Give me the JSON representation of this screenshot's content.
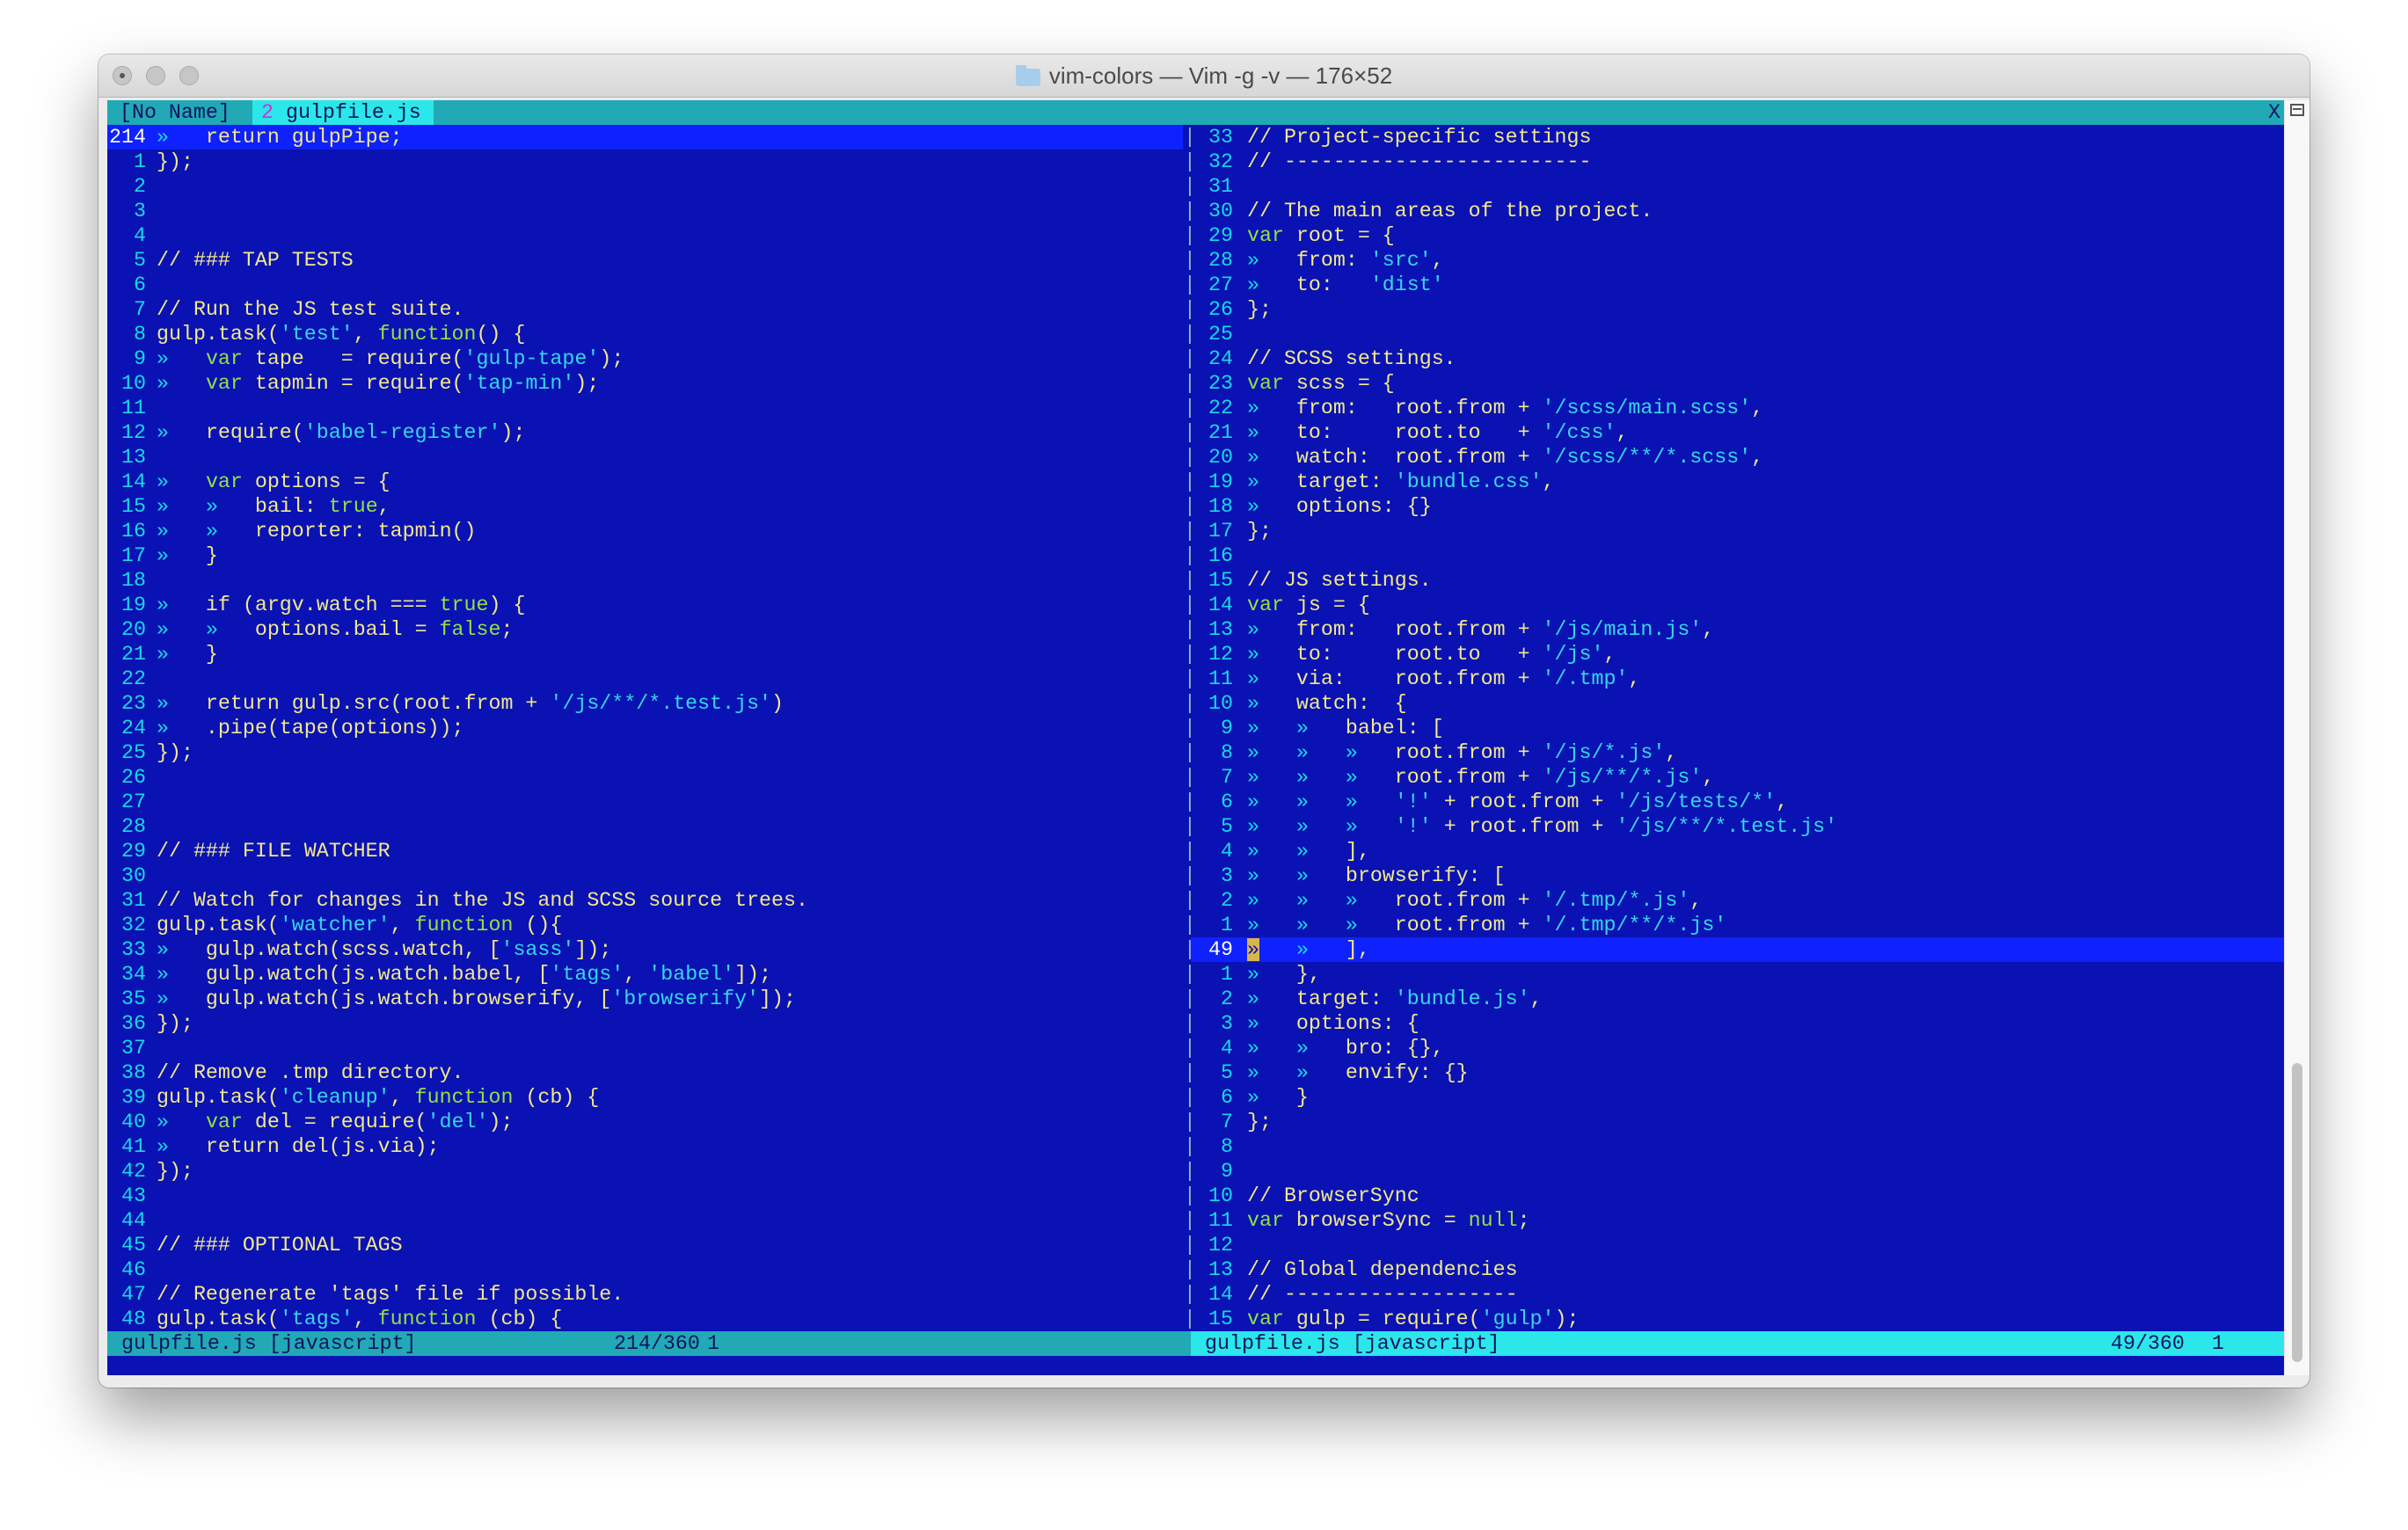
{
  "window": {
    "title": "vim-colors — Vim -g -v — 176×52"
  },
  "tabline": {
    "inactive_tab": "[No Name]",
    "active_tab_number": "2",
    "active_tab_name": "gulpfile.js",
    "close_label": "X"
  },
  "tab_glyph": "»",
  "left_pane": {
    "lines": [
      {
        "n": "214",
        "t": "»   return gulpPipe;"
      },
      {
        "n": "1",
        "t": "});"
      },
      {
        "n": "2",
        "t": ""
      },
      {
        "n": "3",
        "t": ""
      },
      {
        "n": "4",
        "t": ""
      },
      {
        "n": "5",
        "t": "// ### TAP TESTS"
      },
      {
        "n": "6",
        "t": ""
      },
      {
        "n": "7",
        "t": "// Run the JS test suite."
      },
      {
        "n": "8",
        "t": "gulp.task('test', function() {"
      },
      {
        "n": "9",
        "t": "»   var tape   = require('gulp-tape');"
      },
      {
        "n": "10",
        "t": "»   var tapmin = require('tap-min');"
      },
      {
        "n": "11",
        "t": ""
      },
      {
        "n": "12",
        "t": "»   require('babel-register');"
      },
      {
        "n": "13",
        "t": ""
      },
      {
        "n": "14",
        "t": "»   var options = {"
      },
      {
        "n": "15",
        "t": "»   »   bail: true,"
      },
      {
        "n": "16",
        "t": "»   »   reporter: tapmin()"
      },
      {
        "n": "17",
        "t": "»   }"
      },
      {
        "n": "18",
        "t": ""
      },
      {
        "n": "19",
        "t": "»   if (argv.watch === true) {"
      },
      {
        "n": "20",
        "t": "»   »   options.bail = false;"
      },
      {
        "n": "21",
        "t": "»   }"
      },
      {
        "n": "22",
        "t": ""
      },
      {
        "n": "23",
        "t": "»   return gulp.src(root.from + '/js/**/*.test.js')"
      },
      {
        "n": "24",
        "t": "»   .pipe(tape(options));"
      },
      {
        "n": "25",
        "t": "});"
      },
      {
        "n": "26",
        "t": ""
      },
      {
        "n": "27",
        "t": ""
      },
      {
        "n": "28",
        "t": ""
      },
      {
        "n": "29",
        "t": "// ### FILE WATCHER"
      },
      {
        "n": "30",
        "t": ""
      },
      {
        "n": "31",
        "t": "// Watch for changes in the JS and SCSS source trees."
      },
      {
        "n": "32",
        "t": "gulp.task('watcher', function (){"
      },
      {
        "n": "33",
        "t": "»   gulp.watch(scss.watch, ['sass']);"
      },
      {
        "n": "34",
        "t": "»   gulp.watch(js.watch.babel, ['tags', 'babel']);"
      },
      {
        "n": "35",
        "t": "»   gulp.watch(js.watch.browserify, ['browserify']);"
      },
      {
        "n": "36",
        "t": "});"
      },
      {
        "n": "37",
        "t": ""
      },
      {
        "n": "38",
        "t": "// Remove .tmp directory."
      },
      {
        "n": "39",
        "t": "gulp.task('cleanup', function (cb) {"
      },
      {
        "n": "40",
        "t": "»   var del = require('del');"
      },
      {
        "n": "41",
        "t": "»   return del(js.via);"
      },
      {
        "n": "42",
        "t": "});"
      },
      {
        "n": "43",
        "t": ""
      },
      {
        "n": "44",
        "t": ""
      },
      {
        "n": "45",
        "t": "// ### OPTIONAL TAGS"
      },
      {
        "n": "46",
        "t": ""
      },
      {
        "n": "47",
        "t": "// Regenerate 'tags' file if possible."
      },
      {
        "n": "48",
        "t": "gulp.task('tags', function (cb) {"
      }
    ],
    "current_line": 0,
    "status": {
      "file": "gulpfile.js [javascript]",
      "position": "214/360",
      "column": "1"
    }
  },
  "right_pane": {
    "lines": [
      {
        "n": "33",
        "t": "// Project-specific settings"
      },
      {
        "n": "32",
        "t": "// -------------------------"
      },
      {
        "n": "31",
        "t": ""
      },
      {
        "n": "30",
        "t": "// The main areas of the project."
      },
      {
        "n": "29",
        "t": "var root = {"
      },
      {
        "n": "28",
        "t": "»   from: 'src',"
      },
      {
        "n": "27",
        "t": "»   to:   'dist'"
      },
      {
        "n": "26",
        "t": "};"
      },
      {
        "n": "25",
        "t": ""
      },
      {
        "n": "24",
        "t": "// SCSS settings."
      },
      {
        "n": "23",
        "t": "var scss = {"
      },
      {
        "n": "22",
        "t": "»   from:   root.from + '/scss/main.scss',"
      },
      {
        "n": "21",
        "t": "»   to:     root.to   + '/css',"
      },
      {
        "n": "20",
        "t": "»   watch:  root.from + '/scss/**/*.scss',"
      },
      {
        "n": "19",
        "t": "»   target: 'bundle.css',"
      },
      {
        "n": "18",
        "t": "»   options: {}"
      },
      {
        "n": "17",
        "t": "};"
      },
      {
        "n": "16",
        "t": ""
      },
      {
        "n": "15",
        "t": "// JS settings."
      },
      {
        "n": "14",
        "t": "var js = {"
      },
      {
        "n": "13",
        "t": "»   from:   root.from + '/js/main.js',"
      },
      {
        "n": "12",
        "t": "»   to:     root.to   + '/js',"
      },
      {
        "n": "11",
        "t": "»   via:    root.from + '/.tmp',"
      },
      {
        "n": "10",
        "t": "»   watch:  {"
      },
      {
        "n": "9",
        "t": "»   »   babel: ["
      },
      {
        "n": "8",
        "t": "»   »   »   root.from + '/js/*.js',"
      },
      {
        "n": "7",
        "t": "»   »   »   root.from + '/js/**/*.js',"
      },
      {
        "n": "6",
        "t": "»   »   »   '!' + root.from + '/js/tests/*',"
      },
      {
        "n": "5",
        "t": "»   »   »   '!' + root.from + '/js/**/*.test.js'"
      },
      {
        "n": "4",
        "t": "»   »   ],"
      },
      {
        "n": "3",
        "t": "»   »   browserify: ["
      },
      {
        "n": "2",
        "t": "»   »   »   root.from + '/.tmp/*.js',"
      },
      {
        "n": "1",
        "t": "»   »   »   root.from + '/.tmp/**/*.js'"
      },
      {
        "n": "49",
        "t": "»   »   ],"
      },
      {
        "n": "1",
        "t": "»   },"
      },
      {
        "n": "2",
        "t": "»   target: 'bundle.js',"
      },
      {
        "n": "3",
        "t": "»   options: {"
      },
      {
        "n": "4",
        "t": "»   »   bro: {},"
      },
      {
        "n": "5",
        "t": "»   »   envify: {}"
      },
      {
        "n": "6",
        "t": "»   }"
      },
      {
        "n": "7",
        "t": "};"
      },
      {
        "n": "8",
        "t": ""
      },
      {
        "n": "9",
        "t": ""
      },
      {
        "n": "10",
        "t": "// BrowserSync"
      },
      {
        "n": "11",
        "t": "var browserSync = null;"
      },
      {
        "n": "12",
        "t": ""
      },
      {
        "n": "13",
        "t": "// Global dependencies"
      },
      {
        "n": "14",
        "t": "// -------------------"
      },
      {
        "n": "15",
        "t": "var gulp = require('gulp');"
      }
    ],
    "current_line": 33,
    "status": {
      "file": "gulpfile.js [javascript]",
      "position": "49/360",
      "column": "1"
    }
  },
  "colors": {
    "background": "#0a12b3",
    "cursor_line": "#0f21ff",
    "line_number": "#19d9e8",
    "code_text": "#f2e88d",
    "comment": "#f2e88d",
    "string": "#37d6ea",
    "keyword": "#93e045",
    "status_inactive": "#21a9b6",
    "status_active": "#2be7ea"
  }
}
